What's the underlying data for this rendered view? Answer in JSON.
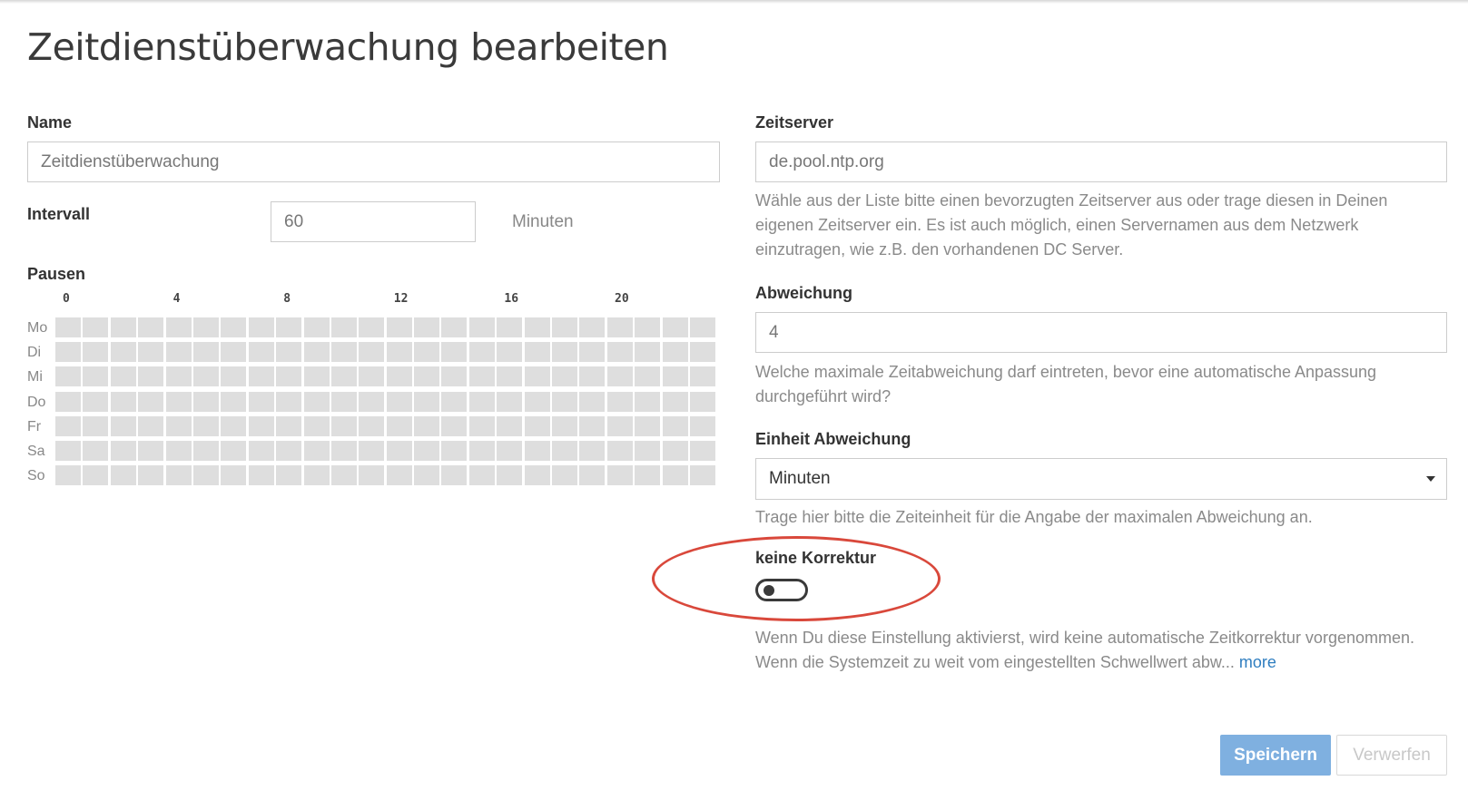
{
  "page": {
    "title": "Zeitdienstüberwachung bearbeiten"
  },
  "name": {
    "label": "Name",
    "value": "Zeitdienstüberwachung"
  },
  "interval": {
    "label": "Intervall",
    "value": "60",
    "unit": "Minuten"
  },
  "pauses": {
    "label": "Pausen",
    "hour_labels": [
      "0",
      "4",
      "8",
      "12",
      "16",
      "20"
    ],
    "days": [
      "Mo",
      "Di",
      "Mi",
      "Do",
      "Fr",
      "Sa",
      "So"
    ],
    "hours_per_day": 24
  },
  "time_server": {
    "label": "Zeitserver",
    "value": "de.pool.ntp.org",
    "help": "Wähle aus der Liste bitte einen bevorzugten Zeitserver aus oder trage diesen in Deinen eigenen Zeitserver ein. Es ist auch möglich, einen Servernamen aus dem Netzwerk einzutragen, wie z.B. den vorhandenen DC Server."
  },
  "deviation": {
    "label": "Abweichung",
    "value": "4",
    "help": "Welche maximale Zeitabweichung darf eintreten, bevor eine automatische Anpassung durchgeführt wird?"
  },
  "deviation_unit": {
    "label": "Einheit Abweichung",
    "selected": "Minuten",
    "help": "Trage hier bitte die Zeiteinheit für die Angabe der maximalen Abweichung an."
  },
  "no_correction": {
    "label": "keine Korrektur",
    "enabled": false,
    "help": "Wenn Du diese Einstellung aktivierst, wird keine automatische Zeitkorrektur vorgenommen. Wenn die Systemzeit zu weit vom eingestellten Schwellwert abw...",
    "more": "more"
  },
  "actions": {
    "save": "Speichern",
    "discard": "Verwerfen"
  },
  "colors": {
    "primary": "#7fb0e0",
    "annotation": "#d9483b",
    "link": "#2f7ec0",
    "cell": "#dedede"
  }
}
